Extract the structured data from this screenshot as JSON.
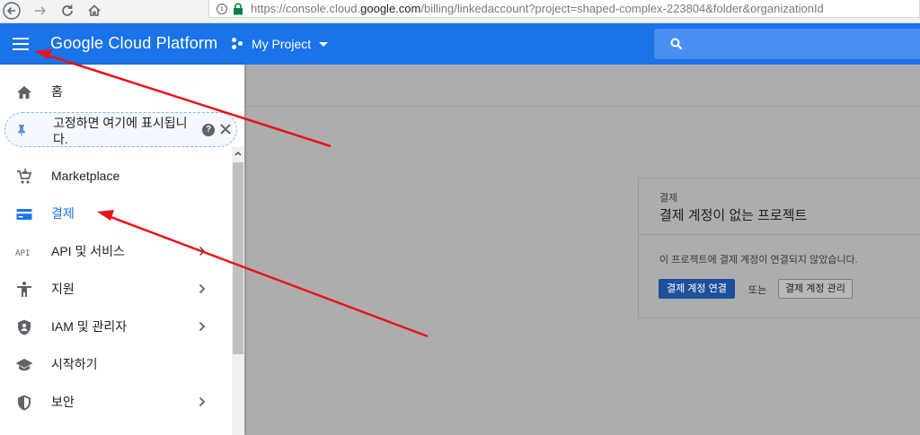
{
  "browser": {
    "url_prefix": "https://console.cloud.",
    "url_domain": "google.com",
    "url_path": "/billing/linkedaccount?project=shaped-complex-223804&folder&organizationId"
  },
  "header": {
    "title": "Google Cloud Platform",
    "project": "My Project",
    "brand_color": "#1a73e8"
  },
  "sidebar": {
    "home_label": "홈",
    "pin_text": "고정하면 여기에 표시됩니다.",
    "pin_help": "?",
    "items": [
      {
        "label": "Marketplace",
        "icon": "cart-icon"
      },
      {
        "label": "결제",
        "icon": "billing-icon",
        "active": true
      },
      {
        "label": "API 및 서비스",
        "icon": "api-icon",
        "chevron": true
      },
      {
        "label": "지원",
        "icon": "support-icon",
        "chevron": true
      },
      {
        "label": "IAM 및 관리자",
        "icon": "shield-icon",
        "chevron": true
      },
      {
        "label": "시작하기",
        "icon": "graduation-cap-icon"
      },
      {
        "label": "보안",
        "icon": "security-shield-icon",
        "chevron": true
      }
    ],
    "active_color": "#1a73e8"
  },
  "card": {
    "section": "결제",
    "title": "결제 계정이 없는 프로젝트",
    "description": "이 프로젝트에 결제 계정이 연결되지 않았습니다.",
    "link_button": "결제 계정 연결",
    "or_text": "또는",
    "manage_button": "결제 계정 관리"
  },
  "annotations": {
    "arrow_color": "#e8141a"
  }
}
